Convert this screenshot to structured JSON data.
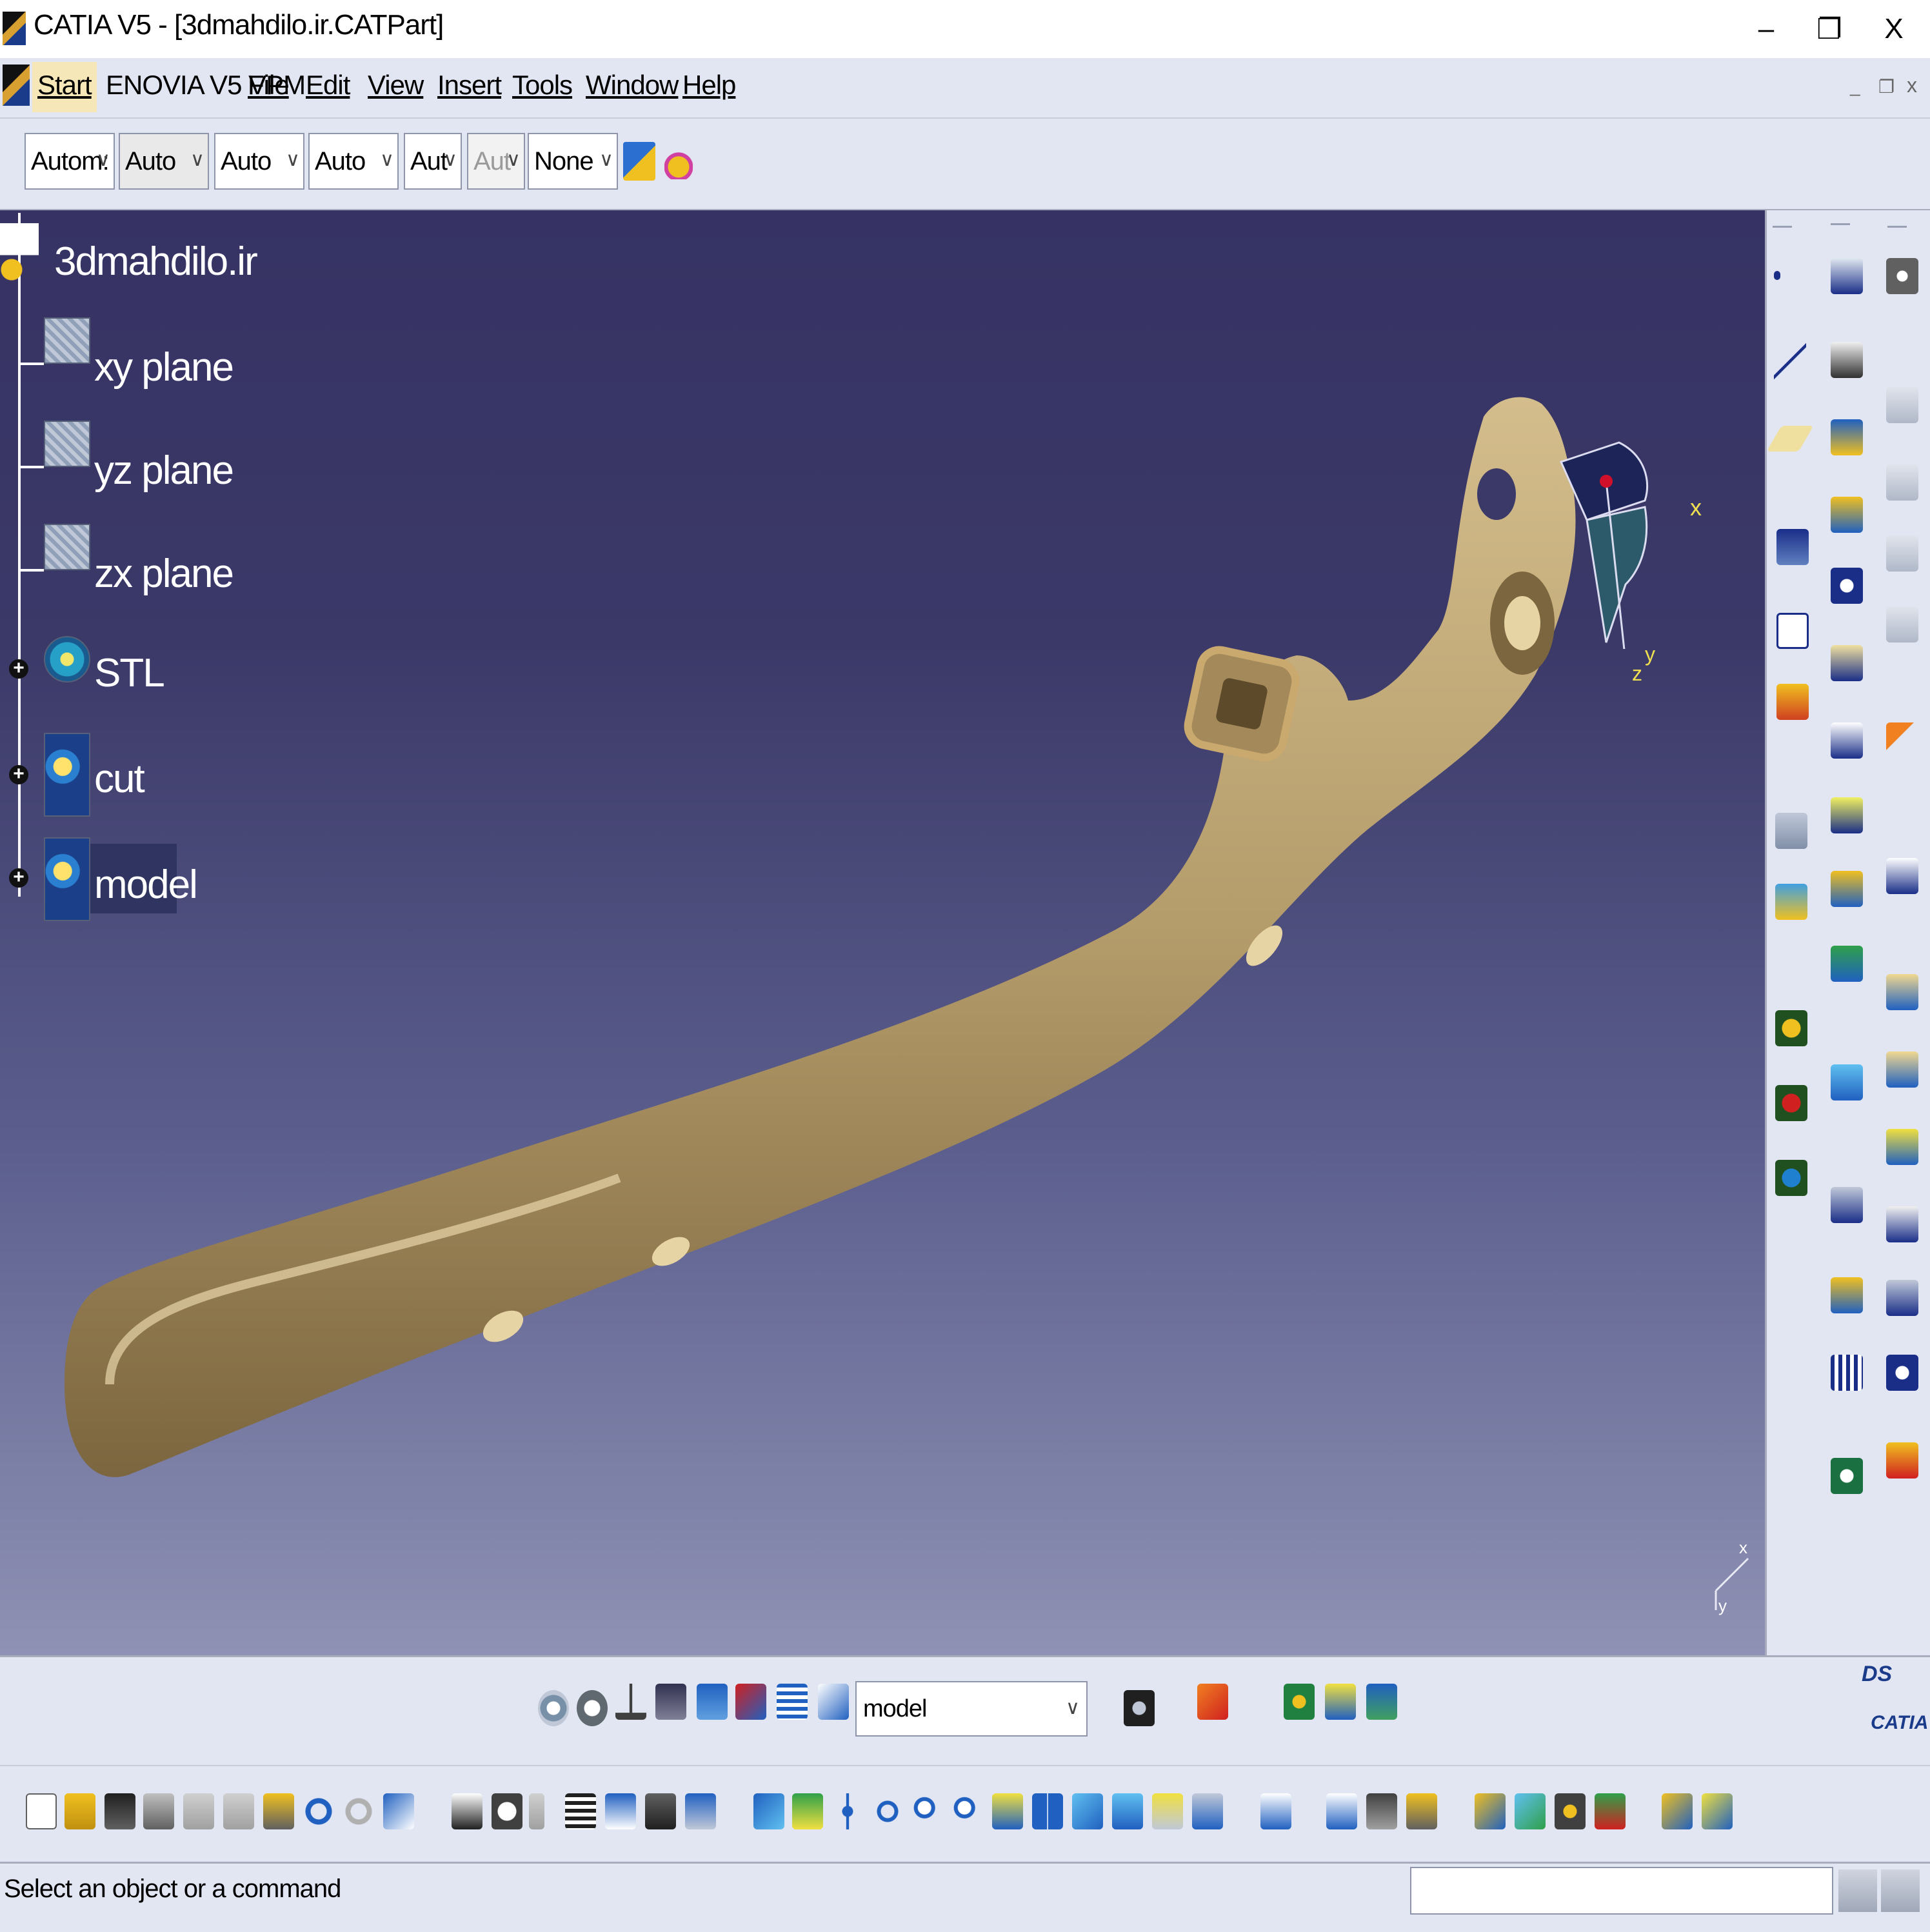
{
  "window": {
    "title": "CATIA V5 - [3dmahdilo.ir.CATPart]",
    "minimize_glyph": "–",
    "restore_glyph": "❐",
    "close_glyph": "X"
  },
  "menu": {
    "start": "Start",
    "enovia": "ENOVIA V5 VPM",
    "file": "File",
    "edit": "Edit",
    "view": "View",
    "insert": "Insert",
    "tools": "Tools",
    "window": "Window",
    "help": "Help",
    "doc_min": "_",
    "doc_restore": "❐",
    "doc_close": "x"
  },
  "graphic_properties": {
    "dd1": "Autom:",
    "dd2": "Auto",
    "dd3": "Auto",
    "dd4": "Auto",
    "dd5": "Aut",
    "dd6": "Aut",
    "dd7": "None"
  },
  "tree": {
    "root": "3dmahdilo.ir",
    "items": [
      {
        "label": "xy plane"
      },
      {
        "label": "yz plane"
      },
      {
        "label": "zx plane"
      },
      {
        "label": "STL"
      },
      {
        "label": "cut"
      },
      {
        "label": "model"
      }
    ]
  },
  "compass": {
    "x": "x",
    "y": "y",
    "z": "z"
  },
  "axis_triad": {
    "x": "x",
    "y": "y"
  },
  "workbench_selector": {
    "value": "model"
  },
  "catia_logo": "CATIA",
  "status": {
    "message": "Select an object or a command"
  },
  "colors": {
    "part": "#b49b6a",
    "viewport_top": "#363364",
    "viewport_bottom": "#8f92b4",
    "toolbar_bg": "#e2e6f2"
  }
}
